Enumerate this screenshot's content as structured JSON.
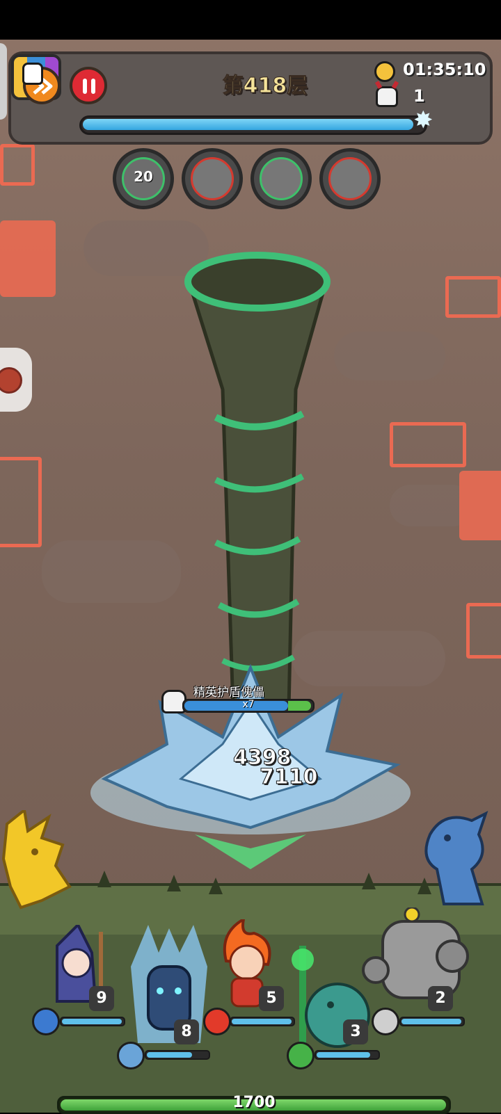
{
  "hud": {
    "floor_title": "第418层",
    "timer": "01:35:10",
    "kill_count": "1",
    "wave_progress": 0.97
  },
  "buffs": [
    {
      "icon": "green-figure-icon",
      "count": "20"
    },
    {
      "icon": "red-sword-icon",
      "count": ""
    },
    {
      "icon": "green-figure-icon",
      "count": ""
    },
    {
      "icon": "red-sword-icon",
      "count": ""
    }
  ],
  "enemy": {
    "name": "精英护盾傀儡",
    "stack": "x7",
    "hp_fraction": 0.82,
    "shield_fraction": 0.18
  },
  "damage_numbers": [
    "4398",
    "7110"
  ],
  "heroes": [
    {
      "name": "mage",
      "level": "9",
      "hp_fraction": 1.0,
      "element": "water-diamond-icon"
    },
    {
      "name": "ice-knight",
      "level": "8",
      "hp_fraction": 0.75,
      "element": "ice-crystal-icon"
    },
    {
      "name": "fire-sprite",
      "level": "5",
      "hp_fraction": 1.0,
      "element": "fire-icon"
    },
    {
      "name": "duck-druid",
      "level": "3",
      "hp_fraction": 0.9,
      "element": "wind-icon"
    },
    {
      "name": "rock-golem",
      "level": "2",
      "hp_fraction": 1.0,
      "element": "rock-icon"
    }
  ],
  "team": {
    "hp_value": "1700",
    "hp_fraction": 1.0
  },
  "colors": {
    "wall": "#7d665b",
    "maze_glow": "#ea6a52",
    "hud_panel": "#5e5754",
    "progress": "#34a5e0",
    "team_hp": "#3fa23a"
  }
}
